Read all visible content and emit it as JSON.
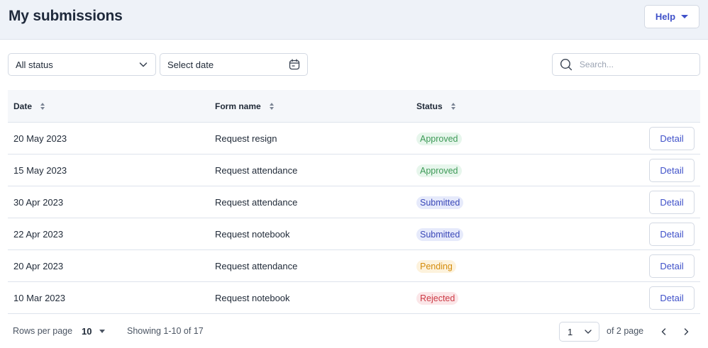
{
  "header": {
    "title": "My submissions",
    "help_label": "Help"
  },
  "filters": {
    "status_value": "All status",
    "date_placeholder": "Select date",
    "search_placeholder": "Search..."
  },
  "table": {
    "columns": {
      "date": "Date",
      "form": "Form name",
      "status": "Status"
    },
    "detail_label": "Detail",
    "rows": [
      {
        "date": "20 May 2023",
        "form": "Request resign",
        "status": "Approved",
        "status_kind": "approved"
      },
      {
        "date": "15 May 2023",
        "form": "Request attendance",
        "status": "Approved",
        "status_kind": "approved"
      },
      {
        "date": "30 Apr 2023",
        "form": "Request attendance",
        "status": "Submitted",
        "status_kind": "submitted"
      },
      {
        "date": "22 Apr 2023",
        "form": "Request notebook",
        "status": "Submitted",
        "status_kind": "submitted"
      },
      {
        "date": "20 Apr 2023",
        "form": "Request attendance",
        "status": "Pending",
        "status_kind": "pending"
      },
      {
        "date": "10 Mar 2023",
        "form": "Request notebook",
        "status": "Rejected",
        "status_kind": "rejected"
      }
    ]
  },
  "footer": {
    "rows_per_page_label": "Rows per page",
    "rows_per_page_value": "10",
    "showing_text": "Showing 1-10 of 17",
    "current_page": "1",
    "of_pages_text": "of 2 page"
  },
  "colors": {
    "accent": "#3f51c9",
    "header_bg": "#eef2f8"
  },
  "icons": {
    "status_dropdown": "chevron-down-icon",
    "date_picker": "calendar-icon",
    "search": "search-icon",
    "prev_page": "chevron-left-icon",
    "next_page": "chevron-right-icon"
  }
}
